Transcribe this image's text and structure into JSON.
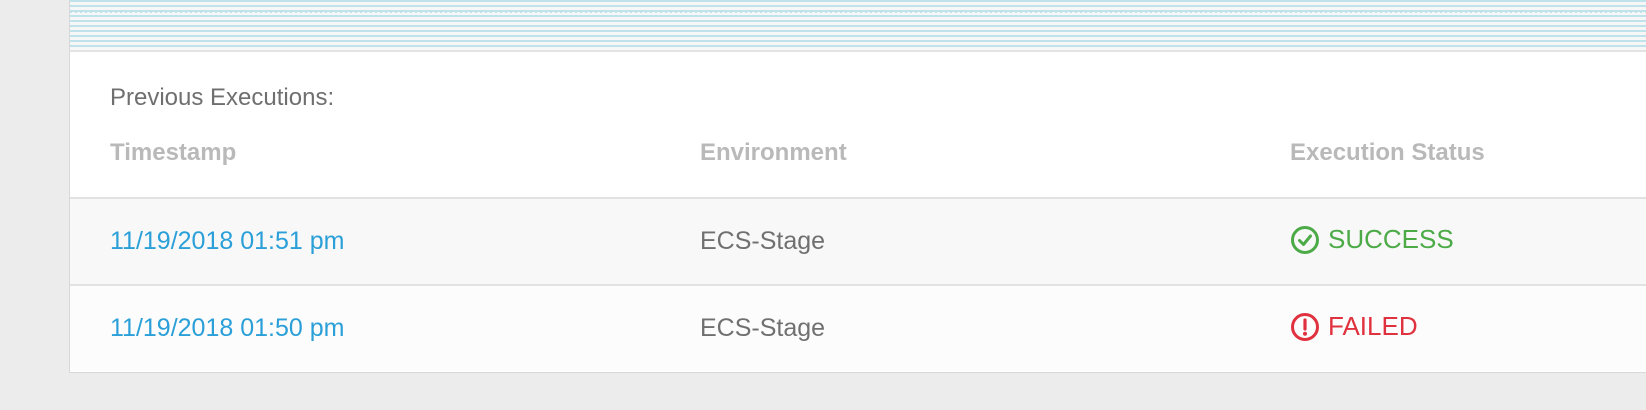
{
  "section_title": "Previous Executions:",
  "columns": [
    "Timestamp",
    "Environment",
    "Execution Status"
  ],
  "rows": [
    {
      "timestamp": "11/19/2018 01:51 pm",
      "environment": "ECS-Stage",
      "status": "SUCCESS",
      "status_icon": "check-circle-icon"
    },
    {
      "timestamp": "11/19/2018 01:50 pm",
      "environment": "ECS-Stage",
      "status": "FAILED",
      "status_icon": "exclamation-circle-icon"
    }
  ],
  "colors": {
    "link": "#2a9fd8",
    "success": "#4caa47",
    "failed": "#e0323e"
  }
}
